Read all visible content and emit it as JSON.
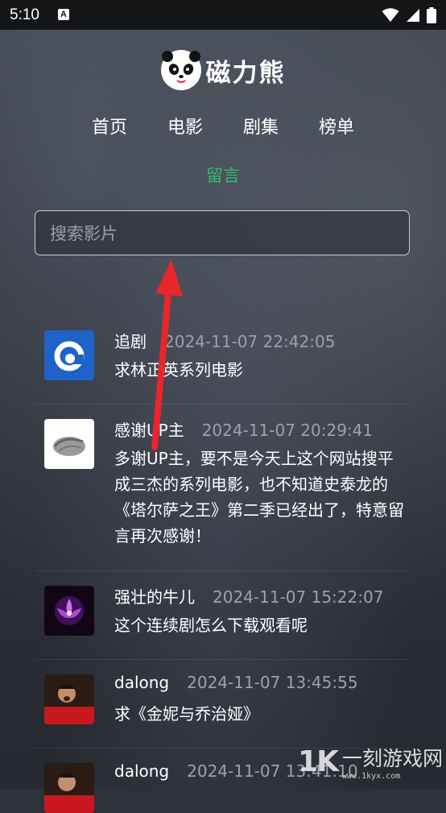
{
  "status": {
    "time": "5:10",
    "notif_letter": "A"
  },
  "app": {
    "title": "磁力熊"
  },
  "nav": {
    "home": "首页",
    "movies": "电影",
    "series": "剧集",
    "rank": "榜单",
    "messages": "留言"
  },
  "search": {
    "placeholder": "搜索影片"
  },
  "comments": [
    {
      "name": "追剧",
      "date": "2024-11-07 22:42:05",
      "text": "求林正英系列电影"
    },
    {
      "name": "感谢UP主",
      "date": "2024-11-07 20:29:41",
      "text": "多谢UP主，要不是今天上这个网站搜平成三杰的系列电影，也不知道史泰龙的《塔尔萨之王》第二季已经出了，特意留言再次感谢！"
    },
    {
      "name": "强壮的牛儿",
      "date": "2024-11-07 15:22:07",
      "text": "这个连续剧怎么下载观看呢"
    },
    {
      "name": "dalong",
      "date": "2024-11-07 13:45:55",
      "text": "求《金妮与乔治娅》"
    },
    {
      "name": "dalong",
      "date": "2024-11-07 13:41:10",
      "text": ""
    }
  ],
  "watermark": {
    "logo": "1K",
    "cn": "一刻游戏网",
    "url": "www.1kyx.com"
  },
  "colors": {
    "accent": "#2fbf71",
    "arrow": "#e8262c"
  }
}
